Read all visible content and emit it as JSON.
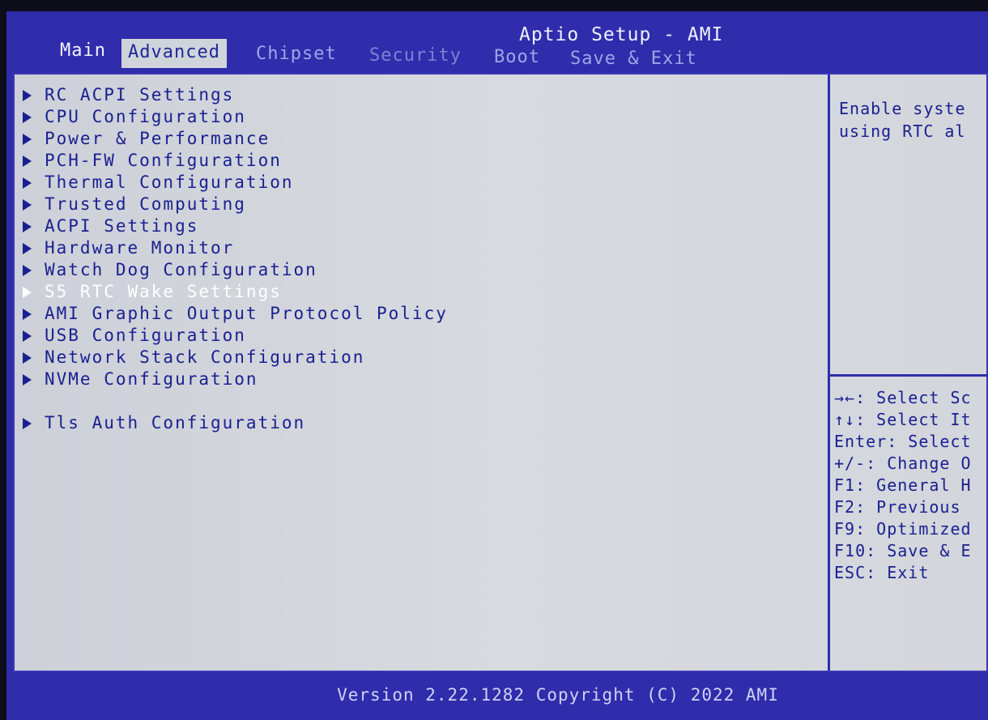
{
  "header": {
    "title": "Aptio Setup - AMI"
  },
  "tabs": [
    {
      "label": "Main"
    },
    {
      "label": "Advanced"
    },
    {
      "label": "Chipset"
    },
    {
      "label": "Security"
    },
    {
      "label": "Boot"
    },
    {
      "label": "Save & Exit"
    }
  ],
  "active_tab": "Advanced",
  "menu": {
    "items": [
      {
        "label": "RC ACPI Settings"
      },
      {
        "label": "CPU Configuration"
      },
      {
        "label": "Power & Performance"
      },
      {
        "label": "PCH-FW Configuration"
      },
      {
        "label": "Thermal Configuration"
      },
      {
        "label": "Trusted Computing"
      },
      {
        "label": "ACPI Settings"
      },
      {
        "label": "Hardware Monitor"
      },
      {
        "label": "Watch Dog Configuration"
      },
      {
        "label": "S5 RTC Wake Settings"
      },
      {
        "label": "AMI Graphic Output Protocol Policy"
      },
      {
        "label": "USB Configuration"
      },
      {
        "label": "Network Stack Configuration"
      },
      {
        "label": "NVMe Configuration"
      },
      {
        "label": "Tls Auth Configuration"
      }
    ],
    "selected": "S5 RTC Wake Settings"
  },
  "help": {
    "line1": "Enable syste",
    "line2": "using RTC al"
  },
  "keys": [
    "→←: Select Sc",
    "↑↓: Select It",
    "Enter: Select",
    "+/-: Change O",
    "F1: General H",
    "F2: Previous",
    "F9: Optimized",
    "F10: Save & E",
    "ESC: Exit"
  ],
  "footer": {
    "text": "Version 2.22.1282 Copyright (C) 2022 AMI"
  },
  "colors": {
    "frame_blue": "#2f2dab",
    "panel_gray": "#d3d6dc",
    "text_blue": "#1a2090",
    "highlight_white": "#ffffff"
  }
}
